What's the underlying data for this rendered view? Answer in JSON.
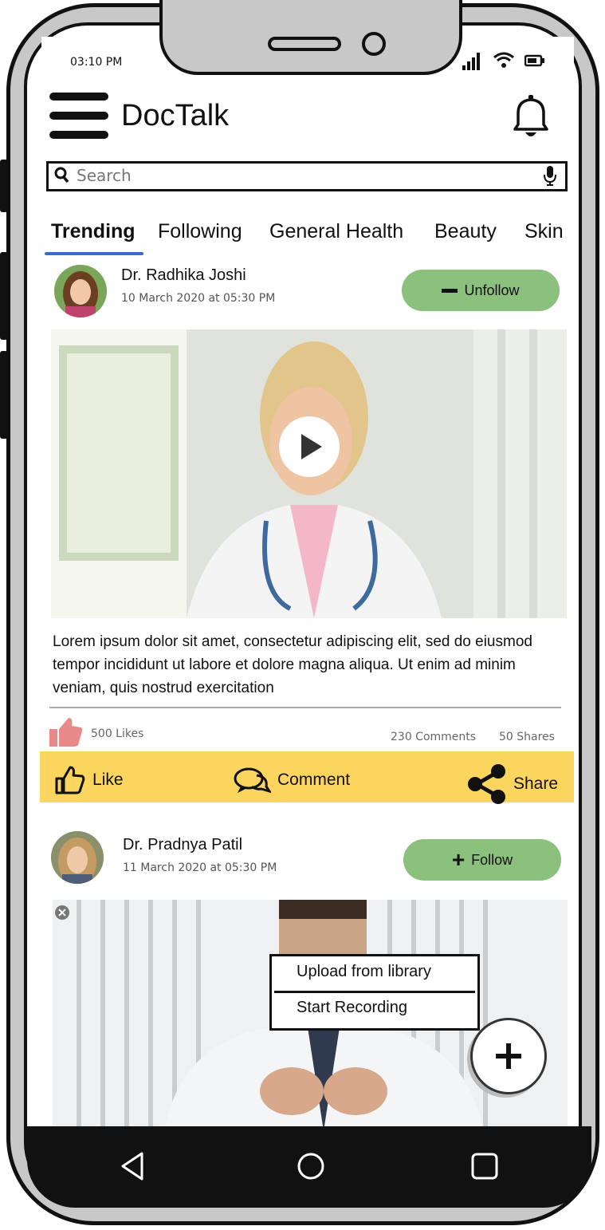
{
  "status_bar": {
    "time": "03:10 PM"
  },
  "header": {
    "title": "DocTalk"
  },
  "search": {
    "placeholder": "Search"
  },
  "tabs": [
    {
      "label": "Trending",
      "active": true
    },
    {
      "label": "Following"
    },
    {
      "label": "General Health"
    },
    {
      "label": "Beauty"
    },
    {
      "label": "Skin"
    }
  ],
  "posts": [
    {
      "author": "Dr. Radhika Joshi",
      "date": "10 March 2020 at 05:30 PM",
      "follow_label": "Unfollow",
      "text": "Lorem ipsum dolor sit amet, consectetur adipiscing elit, sed do eiusmod tempor incididunt ut labore et dolore magna aliqua. Ut enim ad minim veniam, quis nostrud exercitation",
      "likes": "500 Likes",
      "comments": "230 Comments",
      "shares": "50 Shares"
    },
    {
      "author": "Dr. Pradnya Patil",
      "date": "11 March 2020 at 05:30 PM",
      "follow_label": "Follow"
    }
  ],
  "actions": {
    "like": "Like",
    "comment": "Comment",
    "share": "Share"
  },
  "upload_menu": {
    "items": [
      "Upload from library",
      "Start  Recording"
    ]
  },
  "colors": {
    "action_bar": "#fcd55f",
    "follow_button": "#8cc07d",
    "tab_underline": "#3b6cc7"
  }
}
